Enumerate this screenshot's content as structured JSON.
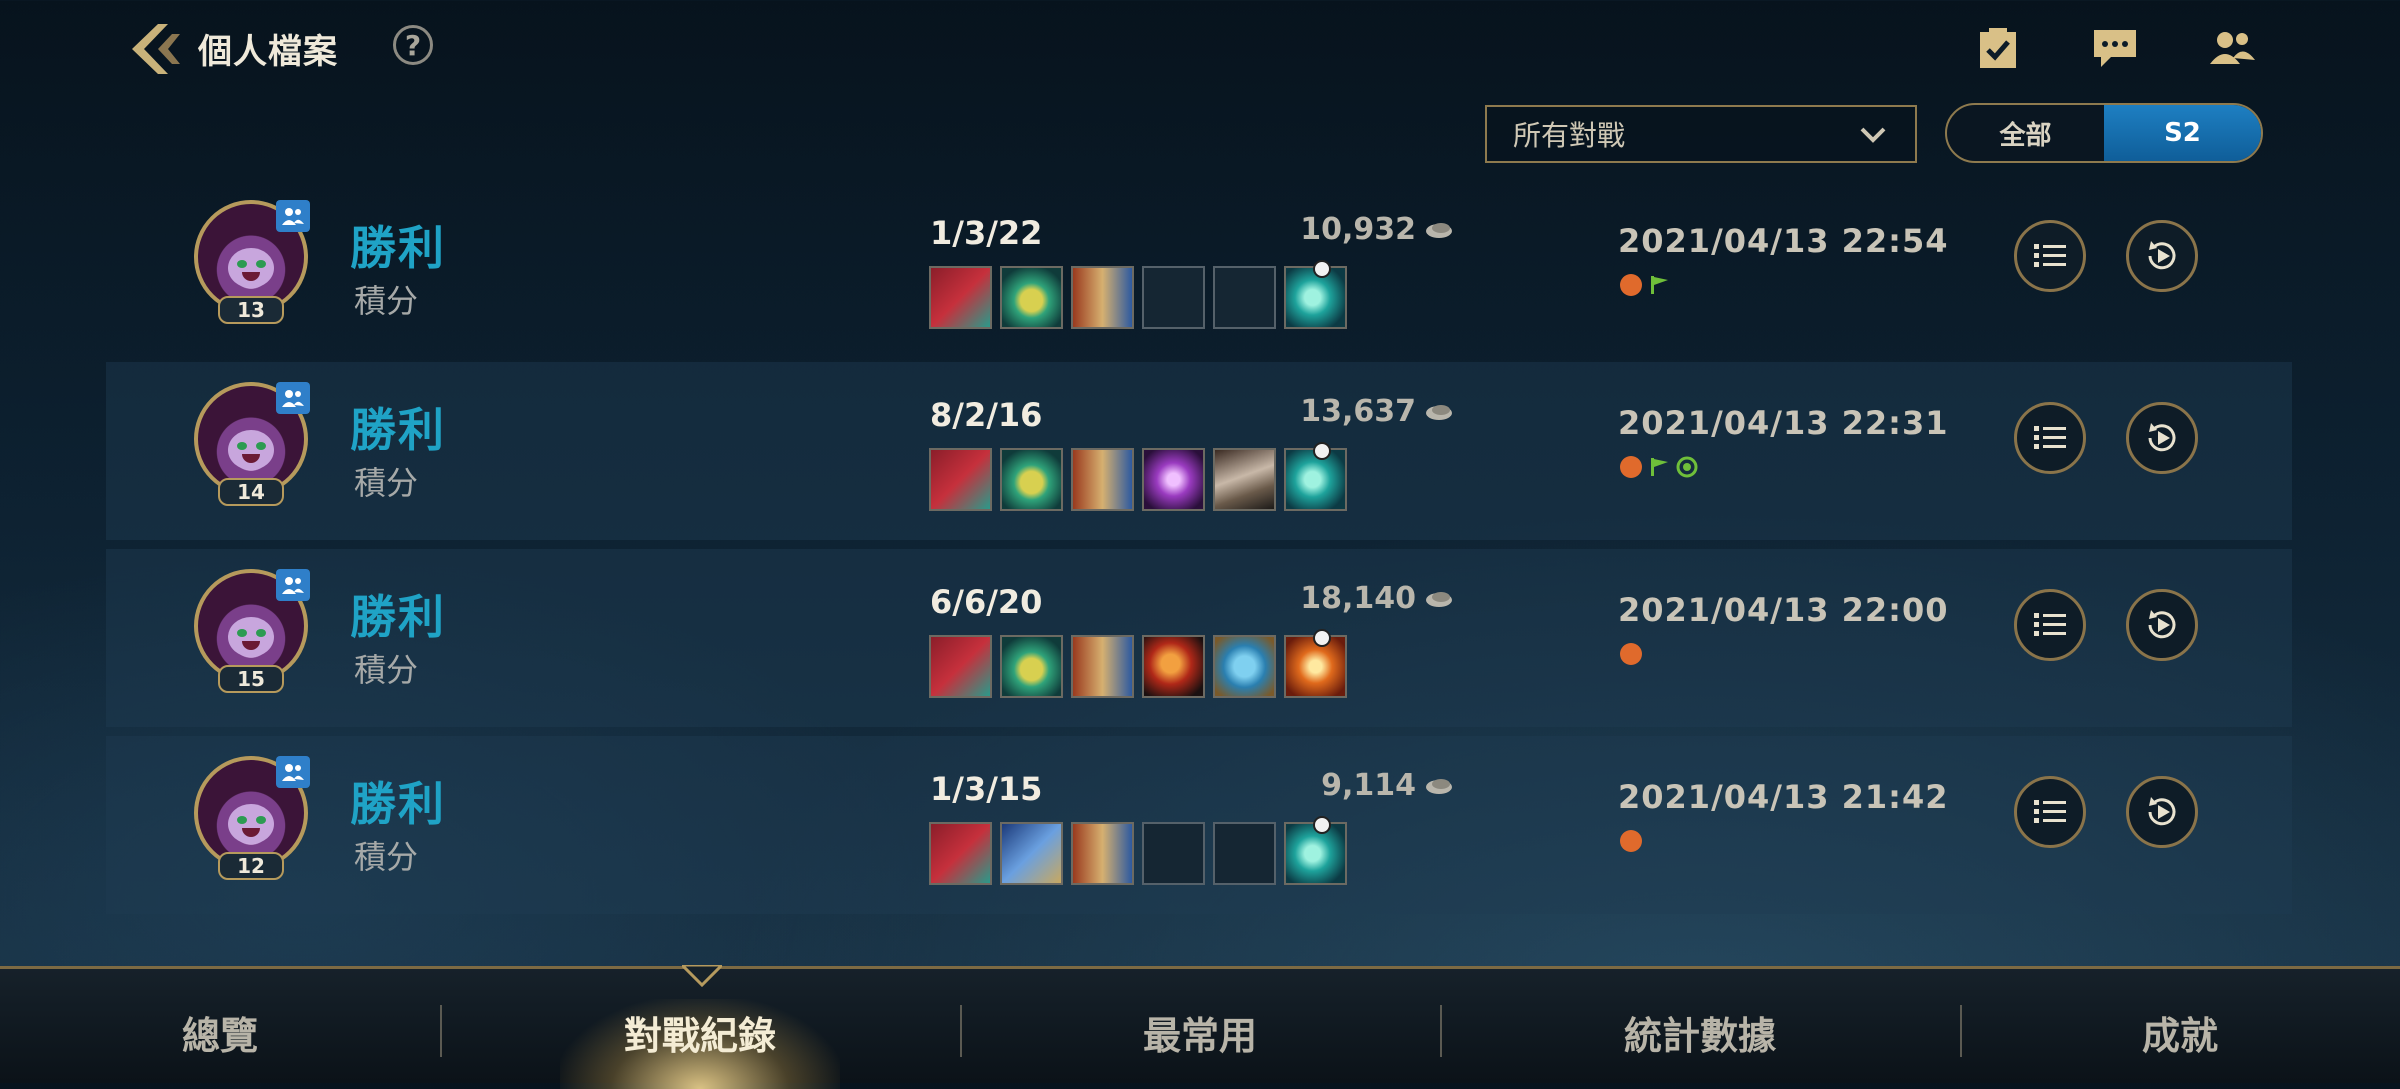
{
  "header": {
    "title": "個人檔案",
    "help": "?"
  },
  "filters": {
    "match_type": "所有對戰",
    "season_options": [
      "全部",
      "S2"
    ],
    "season_selected": "S2"
  },
  "matches": [
    {
      "result": "勝利",
      "mode": "積分",
      "level": "13",
      "kda": "1/3/22",
      "gold": "10,932",
      "datetime": "2021/04/13 22:54"
    },
    {
      "result": "勝利",
      "mode": "積分",
      "level": "14",
      "kda": "8/2/16",
      "gold": "13,637",
      "datetime": "2021/04/13 22:31"
    },
    {
      "result": "勝利",
      "mode": "積分",
      "level": "15",
      "kda": "6/6/20",
      "gold": "18,140",
      "datetime": "2021/04/13 22:00"
    },
    {
      "result": "勝利",
      "mode": "積分",
      "level": "12",
      "kda": "1/3/15",
      "gold": "9,114",
      "datetime": "2021/04/13 21:42"
    }
  ],
  "bottom_nav": {
    "tabs": [
      "總覽",
      "對戰紀錄",
      "最常用",
      "統計數據",
      "成就"
    ],
    "active": "對戰紀錄"
  },
  "colors": {
    "win": "#1fa3c6",
    "gold_border": "#8e7a4e",
    "active_segment": "#1e7fc2"
  }
}
